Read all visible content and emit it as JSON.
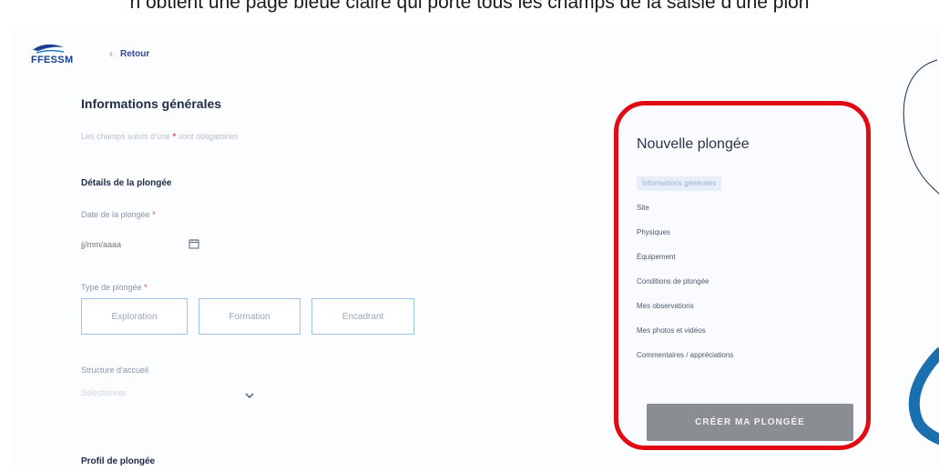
{
  "caption": "n obtient une page bleue claire qui porte tous les champs de la saisie d’une plon",
  "header": {
    "logo_text": "FFESSM",
    "back_label": "Retour"
  },
  "form": {
    "section_title": "Informations générales",
    "hint_prefix": "Les champs suivis d’une",
    "hint_star": "*",
    "hint_suffix": "sont obligatoires",
    "details_title": "Détails de la plongée",
    "date_label": "Date de la plongée",
    "date_placeholder": "jj/mm/aaaa",
    "required_star": "*",
    "type_label": "Type de plongée",
    "type_options": [
      "Exploration",
      "Formation",
      "Encadrant"
    ],
    "structure_label": "Structure d’accueil",
    "structure_placeholder": "Sélectionner",
    "profile_title": "Profil de plongée"
  },
  "panel": {
    "title": "Nouvelle plongée",
    "steps": [
      "Informations générales",
      "Site",
      "Physiques",
      "Équipement",
      "Conditions de plongée",
      "Mes observations",
      "Mes photos et vidéos",
      "Commentaires / appréciations"
    ],
    "active_step_index": 0,
    "submit_label": "CRÉER MA PLONGÉE"
  },
  "colors": {
    "highlight_border": "#e30b13",
    "brand_blue": "#1b3f8f",
    "button_grey": "#8a8d92",
    "type_border": "#9fc2e6",
    "deco_blue": "#1a6fae"
  },
  "icons": [
    "dolphin-logo-icon",
    "chevron-left-icon",
    "calendar-icon",
    "chevron-down-icon"
  ]
}
